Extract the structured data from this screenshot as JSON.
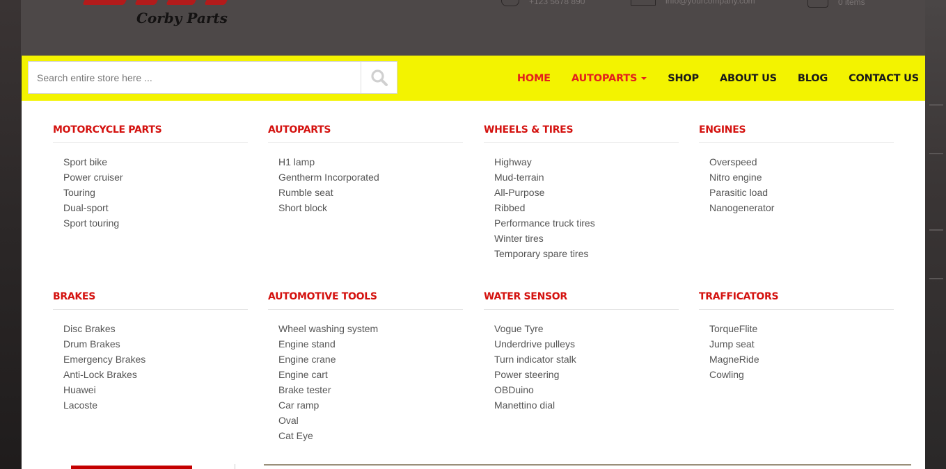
{
  "header": {
    "brand_subtitle": "Corby Parts",
    "phone": "+123 5678 890",
    "email": "info@yourcompany.com",
    "cart": "0 items"
  },
  "search": {
    "placeholder": "Search entire store here ..."
  },
  "nav": {
    "items": [
      {
        "label": "HOME"
      },
      {
        "label": "AUTOPARTS"
      },
      {
        "label": "SHOP"
      },
      {
        "label": "ABOUT US"
      },
      {
        "label": "BLOG"
      },
      {
        "label": "CONTACT US"
      }
    ]
  },
  "megamenu": {
    "columns": [
      {
        "title": "MOTORCYCLE PARTS",
        "items": [
          "Sport bike",
          "Power cruiser",
          "Touring",
          "Dual-sport",
          "Sport touring"
        ]
      },
      {
        "title": "AUTOPARTS",
        "items": [
          "H1 lamp",
          "Gentherm Incorporated",
          "Rumble seat",
          "Short block"
        ]
      },
      {
        "title": "WHEELS & TIRES",
        "items": [
          "Highway",
          "Mud-terrain",
          "All-Purpose",
          "Ribbed",
          "Performance truck tires",
          "Winter tires",
          "Temporary spare tires"
        ]
      },
      {
        "title": "ENGINES",
        "items": [
          "Overspeed",
          "Nitro engine",
          "Parasitic load",
          "Nanogenerator"
        ]
      },
      {
        "title": "BRAKES",
        "items": [
          "Disc Brakes",
          "Drum Brakes",
          "Emergency Brakes",
          "Anti-Lock Brakes",
          "Huawei",
          "Lacoste"
        ]
      },
      {
        "title": "AUTOMOTIVE TOOLS",
        "items": [
          "Wheel washing system",
          "Engine stand",
          "Engine crane",
          "Engine cart",
          "Brake tester",
          "Car ramp",
          "Oval",
          "Cat Eye"
        ]
      },
      {
        "title": "WATER SENSOR",
        "items": [
          "Vogue Tyre",
          "Underdrive pulleys",
          "Turn indicator stalk",
          "Power steering",
          "OBDuino",
          "Manettino dial"
        ]
      },
      {
        "title": "TRAFFICATORS",
        "items": [
          "TorqueFlite",
          "Jump seat",
          "MagneRide",
          "Cowling"
        ]
      }
    ]
  },
  "colors": {
    "nav_bg": "#f3f300",
    "accent_red": "#e3211c",
    "header_bg": "#4d4848"
  }
}
